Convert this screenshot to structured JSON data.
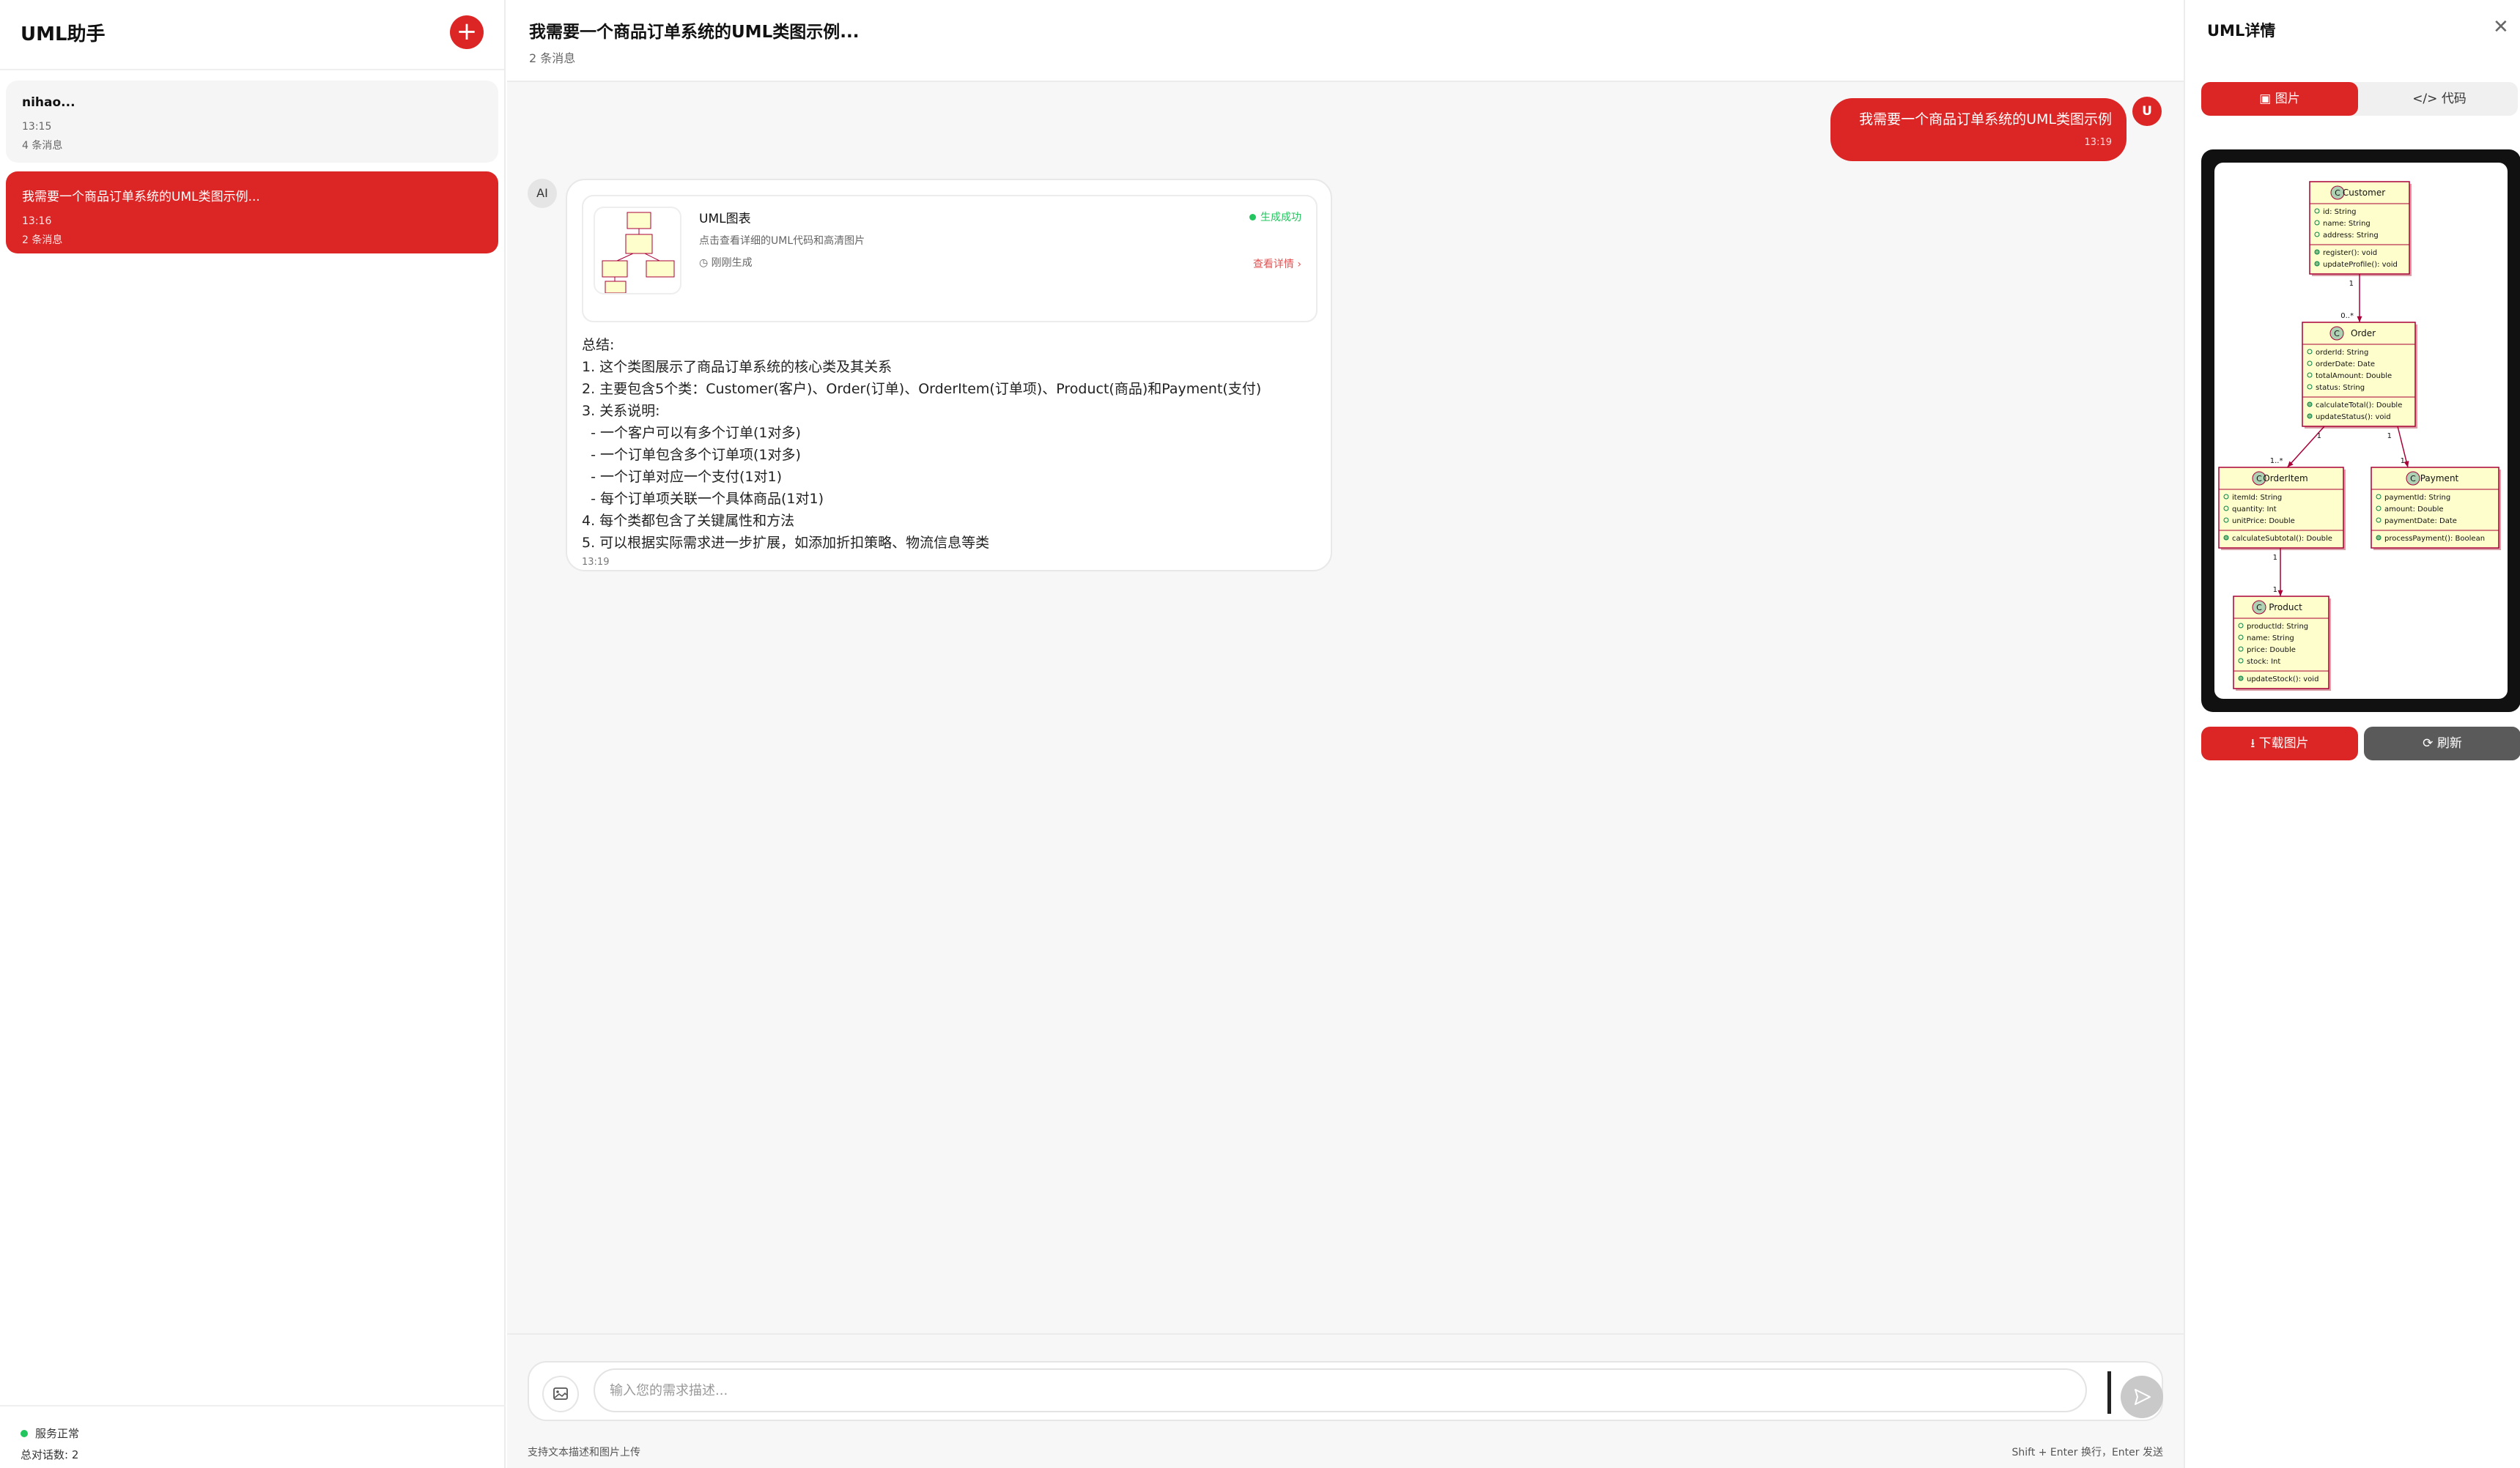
{
  "sidebar": {
    "app_title": "UML助手",
    "new_chat_icon": "plus-icon",
    "conversations": [
      {
        "title": "nihao...",
        "time": "13:15",
        "count": "4 条消息"
      },
      {
        "title": "我需要一个商品订单系统的UML类图示例...",
        "time": "13:16",
        "count": "2 条消息"
      }
    ],
    "status": "服务正常",
    "total": "总对话数: 2"
  },
  "main": {
    "title": "我需要一个商品订单系统的UML类图示例...",
    "subtitle": "2 条消息",
    "user_message": {
      "text": "我需要一个商品订单系统的UML类图示例",
      "time": "13:19",
      "avatar": "U"
    },
    "ai": {
      "avatar": "AI",
      "card": {
        "title": "UML图表",
        "desc": "点击查看详细的UML代码和高清图片",
        "generated": "◷ 刚刚生成",
        "status": "生成成功",
        "link": "查看详情 ›"
      },
      "summary": "总结:\n1. 这个类图展示了商品订单系统的核心类及其关系\n2. 主要包含5个类：Customer(客户)、Order(订单)、OrderItem(订单项)、Product(商品)和Payment(支付)\n3. 关系说明:\n  - 一个客户可以有多个订单(1对多)\n  - 一个订单包含多个订单项(1对多)\n  - 一个订单对应一个支付(1对1)\n  - 每个订单项关联一个具体商品(1对1)\n4. 每个类都包含了关键属性和方法\n5. 可以根据实际需求进一步扩展，如添加折扣策略、物流信息等类",
      "time": "13:19"
    },
    "input": {
      "placeholder": "输入您的需求描述...",
      "hint_left": "支持文本描述和图片上传",
      "hint_right": "Shift + Enter 换行，Enter 发送"
    }
  },
  "detail": {
    "title": "UML详情",
    "close_icon": "close-icon",
    "tab_image": "图片",
    "tab_code": "代码",
    "download": "下载图片",
    "refresh": "刷新"
  },
  "uml": {
    "classes": [
      {
        "name": "Customer",
        "attrs": [
          "id: String",
          "name: String",
          "address: String"
        ],
        "methods": [
          "register(): void",
          "updateProfile(): void"
        ]
      },
      {
        "name": "Order",
        "attrs": [
          "orderId: String",
          "orderDate: Date",
          "totalAmount: Double",
          "status: String"
        ],
        "methods": [
          "calculateTotal(): Double",
          "updateStatus(): void"
        ]
      },
      {
        "name": "OrderItem",
        "attrs": [
          "itemId: String",
          "quantity: Int",
          "unitPrice: Double"
        ],
        "methods": [
          "calculateSubtotal(): Double"
        ]
      },
      {
        "name": "Payment",
        "attrs": [
          "paymentId: String",
          "amount: Double",
          "paymentDate: Date"
        ],
        "methods": [
          "processPayment(): Boolean"
        ]
      },
      {
        "name": "Product",
        "attrs": [
          "productId: String",
          "name: String",
          "price: Double",
          "stock: Int"
        ],
        "methods": [
          "updateStock(): void"
        ]
      }
    ],
    "multiplicities": {
      "cust_order_top": "1",
      "cust_order_bottom": "0..*",
      "order_item_top": "1",
      "order_item_bottom": "1..*",
      "order_pay_top": "1",
      "order_pay_bottom": "1",
      "item_product_top": "1",
      "item_product_bottom": "1"
    },
    "colors": {
      "box_fill": "#fefecd",
      "box_stroke": "#a80036",
      "header_icon": "#add1b2"
    }
  }
}
